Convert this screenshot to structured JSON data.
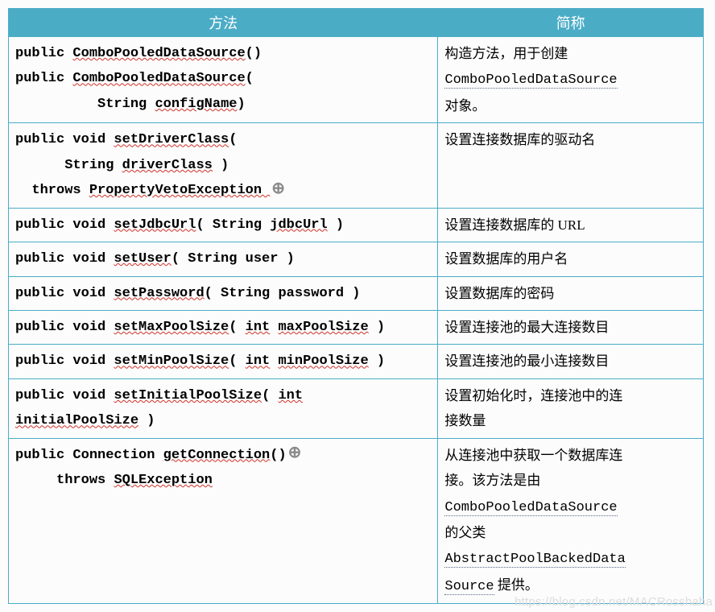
{
  "headers": {
    "method": "方法",
    "desc": "简称"
  },
  "rows": [
    {
      "method": [
        [
          {
            "t": "public "
          },
          {
            "t": "ComboPooledDataSource",
            "u": true
          },
          {
            "t": "()"
          }
        ],
        [
          {
            "t": "public "
          },
          {
            "t": "ComboPooledDataSource",
            "u": true
          },
          {
            "t": "("
          }
        ],
        [
          {
            "t": "          String "
          },
          {
            "t": "configName",
            "u": true
          },
          {
            "t": ")"
          }
        ]
      ],
      "desc": [
        [
          {
            "t": "构造方法，用于创建"
          }
        ],
        [
          {
            "t": "ComboPooledDataSource",
            "mono": true,
            "ue": true
          }
        ],
        [
          {
            "t": "对象。"
          }
        ]
      ]
    },
    {
      "method": [
        [
          {
            "t": "public void "
          },
          {
            "t": "setDriverClass",
            "u": true
          },
          {
            "t": "("
          }
        ],
        [
          {
            "t": "      String "
          },
          {
            "t": "driverClass",
            "u": true
          },
          {
            "t": " )"
          }
        ],
        [
          {
            "t": "  throws "
          },
          {
            "t": "PropertyVetoException ",
            "u": true
          },
          {
            "anchor": true
          }
        ]
      ],
      "desc": [
        [
          {
            "t": "设置连接数据库的驱动名"
          }
        ]
      ]
    },
    {
      "method": [
        [
          {
            "t": "public void "
          },
          {
            "t": "setJdbcUrl",
            "u": true
          },
          {
            "t": "( String "
          },
          {
            "t": "jdbcUrl",
            "u": true
          },
          {
            "t": " )"
          }
        ]
      ],
      "desc": [
        [
          {
            "t": "设置连接数据库的 URL"
          }
        ]
      ]
    },
    {
      "method": [
        [
          {
            "t": "public void "
          },
          {
            "t": "setUser",
            "u": true
          },
          {
            "t": "( String user )"
          }
        ]
      ],
      "desc": [
        [
          {
            "t": "设置数据库的用户名"
          }
        ]
      ]
    },
    {
      "method": [
        [
          {
            "t": "public void "
          },
          {
            "t": "setPassword",
            "u": true
          },
          {
            "t": "( String password )"
          }
        ]
      ],
      "desc": [
        [
          {
            "t": "设置数据库的密码"
          }
        ]
      ]
    },
    {
      "method": [
        [
          {
            "t": "public void "
          },
          {
            "t": "setMaxPoolSize",
            "u": true
          },
          {
            "t": "( "
          },
          {
            "t": "int",
            "u": true
          },
          {
            "t": " "
          },
          {
            "t": "maxPoolSize",
            "u": true
          },
          {
            "t": " )"
          }
        ]
      ],
      "desc": [
        [
          {
            "t": "设置连接池的最大连接数目"
          }
        ]
      ]
    },
    {
      "method": [
        [
          {
            "t": "public void "
          },
          {
            "t": "setMinPoolSize",
            "u": true
          },
          {
            "t": "( "
          },
          {
            "t": "int",
            "u": true
          },
          {
            "t": " "
          },
          {
            "t": "minPoolSize",
            "u": true
          },
          {
            "t": " )"
          }
        ]
      ],
      "desc": [
        [
          {
            "t": "设置连接池的最小连接数目"
          }
        ]
      ]
    },
    {
      "method": [
        [
          {
            "t": "public void "
          },
          {
            "t": "setInitialPoolSize",
            "u": true
          },
          {
            "t": "( "
          },
          {
            "t": "int",
            "u": true
          }
        ],
        [
          {
            "t": "initialPoolSize",
            "u": true
          },
          {
            "t": " )"
          }
        ]
      ],
      "desc": [
        [
          {
            "t": "设置初始化时，连接池中的连"
          }
        ],
        [
          {
            "t": "接数量"
          }
        ]
      ]
    },
    {
      "method": [
        [
          {
            "t": "public Connection "
          },
          {
            "t": "getConnection",
            "u": true
          },
          {
            "t": "()"
          },
          {
            "anchor": true
          }
        ],
        [
          {
            "t": "     throws "
          },
          {
            "t": "SQLException",
            "u": true
          }
        ]
      ],
      "desc": [
        [
          {
            "t": "从连接池中获取一个数据库连"
          }
        ],
        [
          {
            "t": "接。该方法是由"
          }
        ],
        [
          {
            "t": "ComboPooledDataSource",
            "mono": true,
            "ue": true
          }
        ],
        [
          {
            "t": "的父类"
          }
        ],
        [
          {
            "t": "AbstractPoolBackedData",
            "mono": true,
            "ue": true
          }
        ],
        [
          {
            "t": "Source",
            "mono": true,
            "ue": true
          },
          {
            "t": " 提供。"
          }
        ]
      ]
    }
  ],
  "watermark": "https://blog.csdn.net/MACRosshaha"
}
